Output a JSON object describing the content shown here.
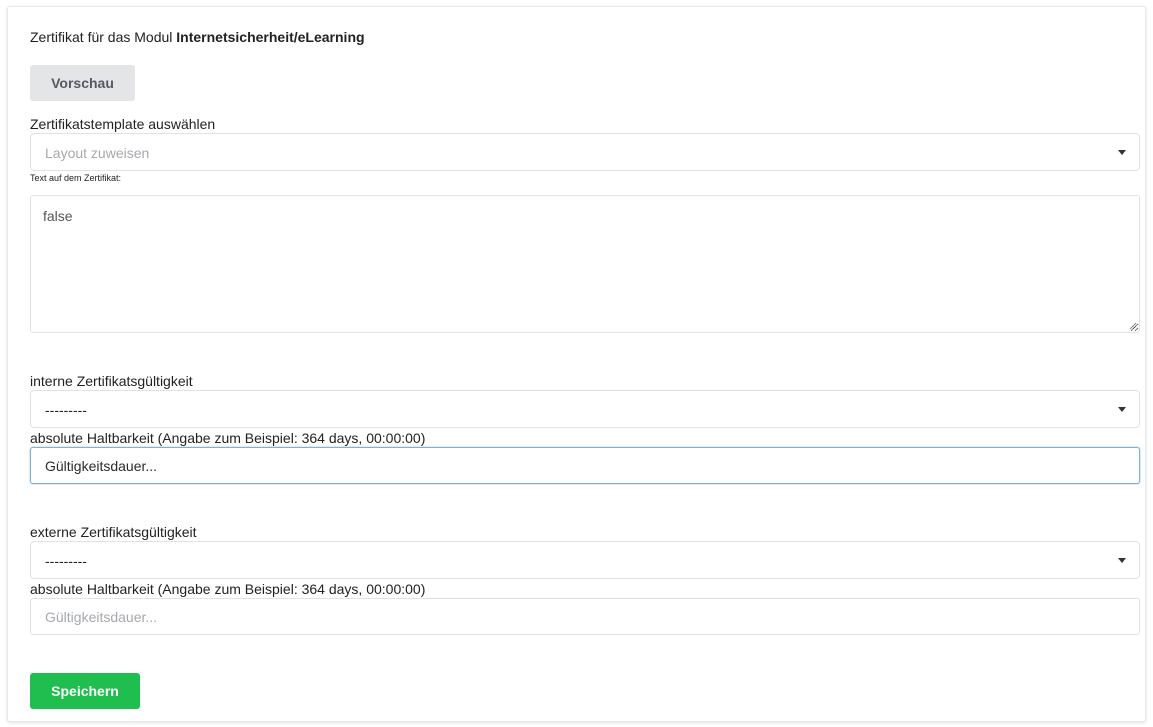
{
  "header": {
    "title_prefix": "Zertifikat für das Modul",
    "module_name": "Internetsicherheit/eLearning"
  },
  "actions": {
    "preview_label": "Vorschau",
    "save_label": "Speichern"
  },
  "template": {
    "label": "Zertifikatstemplate auswählen",
    "placeholder": "Layout zuweisen"
  },
  "certificate_text": {
    "label": "Text auf dem Zertifikat:",
    "value": "false"
  },
  "internal_validity": {
    "label": "interne Zertifikatsgültigkeit",
    "selected": "---------",
    "duration_label": "absolute Haltbarkeit (Angabe zum Beispiel: 364 days, 00:00:00)",
    "duration_placeholder": "Gültigkeitsdauer..."
  },
  "external_validity": {
    "label": "externe Zertifikatsgültigkeit",
    "selected": "---------",
    "duration_label": "absolute Haltbarkeit (Angabe zum Beispiel: 364 days, 00:00:00)",
    "duration_placeholder": "Gültigkeitsdauer..."
  },
  "colors": {
    "save_button": "#1fbe4f",
    "preview_button": "#e4e5e7",
    "focus_border": "#7fb2d4"
  },
  "icons": {
    "dropdown": "caret-down-icon"
  }
}
